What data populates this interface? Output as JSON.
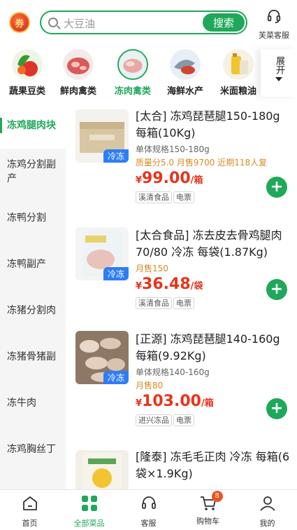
{
  "header": {
    "logo_text": "券",
    "search_placeholder": "大豆油",
    "search_button": "搜索",
    "service_label": "芙菜客服"
  },
  "categories": [
    {
      "label": "蔬果豆类",
      "icon": "vegetables-icon",
      "active": false
    },
    {
      "label": "鲜肉禽类",
      "icon": "fresh-meat-icon",
      "active": false
    },
    {
      "label": "冻肉禽类",
      "icon": "frozen-meat-icon",
      "active": true
    },
    {
      "label": "海鲜水产",
      "icon": "seafood-icon",
      "active": false
    },
    {
      "label": "米面粮油",
      "icon": "grain-oil-icon",
      "active": false
    }
  ],
  "expand_label": "展开",
  "sidebar": [
    {
      "label": "冻鸡腿肉块",
      "active": true
    },
    {
      "label": "冻鸡分割副产",
      "active": false
    },
    {
      "label": "冻鸭分割",
      "active": false
    },
    {
      "label": "冻鸭副产",
      "active": false
    },
    {
      "label": "冻猪分割肉",
      "active": false
    },
    {
      "label": "冻猪骨猪副",
      "active": false
    },
    {
      "label": "冻牛肉",
      "active": false
    },
    {
      "label": "冻鸡胸丝丁",
      "active": false
    }
  ],
  "products": [
    {
      "title": "[太合] 冻鸡琵琶腿150-180g 每箱(10Kg)",
      "spec": "单体规格150-180g",
      "sales": "质量分5.0 月售9700  近期118人复",
      "price_cur": "¥",
      "price": "99.00",
      "unit": "/箱",
      "tag": "冷冻",
      "chips": [
        "溪清食品",
        "电票"
      ]
    },
    {
      "title": "[太合食品] 冻去皮去骨鸡腿肉70/80 冷冻 每袋(1.87Kg)",
      "spec": "",
      "sales": "月售150",
      "price_cur": "¥",
      "price": "36.48",
      "unit": "/袋",
      "tag": "冷冻",
      "chips": [
        "溪清食品",
        "电票"
      ]
    },
    {
      "title": "[正源] 冻鸡琵琶腿140-160g  每箱(9.92Kg)",
      "spec": "单体规格140-160g",
      "sales": "月售80",
      "price_cur": "¥",
      "price": "103.00",
      "unit": "/箱",
      "tag": "冷冻",
      "chips": [
        "进兴冻品",
        "电票"
      ]
    },
    {
      "title": "[隆泰] 冻毛毛正肉 冷冻 每箱(6袋×1.9Kg)",
      "spec": "",
      "sales": "",
      "price_cur": "",
      "price": "",
      "unit": "",
      "tag": "",
      "chips": []
    }
  ],
  "tabbar": [
    {
      "label": "首页",
      "active": false
    },
    {
      "label": "全部菜品",
      "active": true
    },
    {
      "label": "客服",
      "active": false
    },
    {
      "label": "购物车",
      "active": false,
      "badge": "8"
    },
    {
      "label": "我的",
      "active": false
    }
  ],
  "colors": {
    "accent": "#1fa85a",
    "price": "#e8341c",
    "sales": "#d98a21",
    "frozen_tag": "#2e7df6"
  }
}
